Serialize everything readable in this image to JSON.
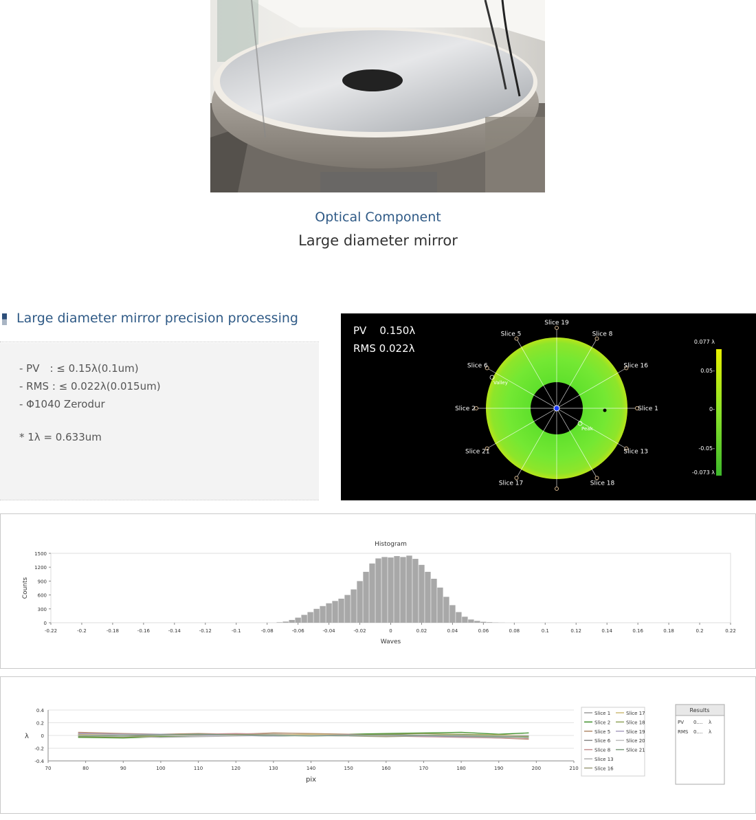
{
  "caption": {
    "category": "Optical Component",
    "title": "Large diameter mirror"
  },
  "section": {
    "title": "Large diameter mirror precision processing",
    "specs": [
      "- PV　: ≤ 0.15λ(0.1um)",
      "- RMS : ≤ 0.022λ(0.015um)",
      "- Φ1040 Zerodur"
    ],
    "note": "* 1λ = 0.633um"
  },
  "wavefront": {
    "pv_label": "PV",
    "pv_value": "0.150λ",
    "rms_label": "RMS",
    "rms_value": "0.022λ",
    "colorbar_ticks": [
      "0.077 λ",
      "0.05-",
      "0-",
      "-0.05-",
      "-0.073 λ"
    ],
    "slices": [
      {
        "label": "Slice 1",
        "angle": 0
      },
      {
        "label": "Slice 16",
        "angle": 30
      },
      {
        "label": "Slice 8",
        "angle": 60
      },
      {
        "label": "Slice 19",
        "angle": 90
      },
      {
        "label": "Slice 5",
        "angle": 120
      },
      {
        "label": "Slice 6",
        "angle": 150
      },
      {
        "label": "Slice 2",
        "angle": 180
      },
      {
        "label": "Slice 21",
        "angle": 210
      },
      {
        "label": "Slice 17",
        "angle": 240
      },
      {
        "label": "",
        "angle": 270
      },
      {
        "label": "Slice 18",
        "angle": 300
      },
      {
        "label": "Slice 13",
        "angle": 330
      }
    ],
    "valley_label": "Valley",
    "peak_label": "Peak",
    "colors": {
      "ring": "#6be82a",
      "ring_edge": "#9ee000",
      "background": "#000000"
    }
  },
  "chart_data": [
    {
      "type": "bar",
      "title": "Histogram",
      "xlabel": "Waves",
      "ylabel": "Counts",
      "xlim": [
        -0.22,
        0.22
      ],
      "ylim": [
        0,
        1500
      ],
      "x_ticks": [
        -0.22,
        -0.2,
        -0.18,
        -0.16,
        -0.14,
        -0.12,
        -0.1,
        -0.08,
        -0.06,
        -0.04,
        -0.02,
        0,
        0.02,
        0.04,
        0.06,
        0.08,
        0.1,
        0.12,
        0.14,
        0.16,
        0.18,
        0.2,
        0.22
      ],
      "y_ticks": [
        0,
        300,
        600,
        900,
        1200,
        1500
      ],
      "x": [
        -0.072,
        -0.068,
        -0.064,
        -0.06,
        -0.056,
        -0.052,
        -0.048,
        -0.044,
        -0.04,
        -0.036,
        -0.032,
        -0.028,
        -0.024,
        -0.02,
        -0.016,
        -0.012,
        -0.008,
        -0.004,
        0,
        0.004,
        0.008,
        0.012,
        0.016,
        0.02,
        0.024,
        0.028,
        0.032,
        0.036,
        0.04,
        0.044,
        0.048,
        0.052,
        0.056,
        0.06,
        0.064,
        0.068,
        0.072
      ],
      "values": [
        10,
        25,
        60,
        110,
        170,
        230,
        300,
        360,
        420,
        470,
        520,
        600,
        720,
        900,
        1100,
        1280,
        1390,
        1420,
        1410,
        1440,
        1420,
        1450,
        1380,
        1250,
        1100,
        950,
        760,
        560,
        380,
        230,
        130,
        70,
        40,
        20,
        12,
        6,
        3
      ],
      "grid": false,
      "bar_color": "#a8a8a8"
    },
    {
      "type": "line",
      "xlabel": "pix",
      "ylabel": "λ",
      "xlim": [
        70,
        210
      ],
      "ylim": [
        -0.4,
        0.4
      ],
      "x_ticks": [
        70,
        80,
        90,
        100,
        110,
        120,
        130,
        140,
        150,
        160,
        170,
        180,
        190,
        200,
        210
      ],
      "y_ticks": [
        -0.4,
        -0.2,
        0,
        0.2,
        0.4
      ],
      "grid": true,
      "legend": "right",
      "x": [
        78,
        90,
        100,
        110,
        120,
        130,
        140,
        150,
        160,
        170,
        180,
        190,
        198
      ],
      "series": [
        {
          "name": "Slice 1",
          "color": "#9a9a9a",
          "values": [
            0.02,
            0.01,
            0.0,
            0.01,
            0.02,
            0.01,
            0.0,
            0.01,
            0.02,
            0.0,
            -0.01,
            -0.02,
            -0.01
          ]
        },
        {
          "name": "Slice 2",
          "color": "#3e8f2a",
          "values": [
            -0.03,
            -0.04,
            -0.02,
            -0.01,
            0.0,
            -0.01,
            0.0,
            0.02,
            0.03,
            0.04,
            0.05,
            0.02,
            0.04
          ]
        },
        {
          "name": "Slice 5",
          "color": "#b08a6a",
          "values": [
            0.05,
            0.03,
            0.02,
            0.03,
            0.02,
            0.04,
            0.03,
            0.02,
            0.01,
            0.0,
            -0.02,
            -0.04,
            -0.06
          ]
        },
        {
          "name": "Slice 6",
          "color": "#8a8a8a",
          "values": [
            0.0,
            -0.02,
            -0.01,
            0.0,
            0.01,
            0.0,
            0.01,
            0.0,
            -0.01,
            0.0,
            0.01,
            0.0,
            0.0
          ]
        },
        {
          "name": "Slice 8",
          "color": "#c28e8e",
          "values": [
            0.04,
            0.02,
            0.01,
            0.02,
            0.03,
            0.02,
            0.01,
            0.0,
            -0.01,
            -0.02,
            -0.03,
            -0.04,
            -0.05
          ]
        },
        {
          "name": "Slice 13",
          "color": "#b0b0b0",
          "values": [
            -0.01,
            -0.02,
            -0.03,
            -0.02,
            -0.01,
            0.0,
            0.01,
            0.01,
            0.0,
            -0.01,
            -0.02,
            -0.03,
            -0.02
          ]
        },
        {
          "name": "Slice 16",
          "color": "#9c9c7a",
          "values": [
            0.02,
            0.0,
            -0.01,
            0.0,
            0.01,
            0.02,
            0.0,
            -0.01,
            -0.02,
            -0.01,
            0.0,
            0.01,
            0.0
          ]
        },
        {
          "name": "Slice 17",
          "color": "#cdbb77",
          "values": [
            0.01,
            0.02,
            0.01,
            0.0,
            0.0,
            0.01,
            0.02,
            0.01,
            0.0,
            0.01,
            0.02,
            0.01,
            0.0
          ]
        },
        {
          "name": "Slice 18",
          "color": "#8fa35a",
          "values": [
            -0.02,
            -0.03,
            -0.01,
            0.0,
            0.01,
            0.0,
            0.0,
            0.01,
            0.02,
            0.03,
            0.02,
            0.0,
            -0.02
          ]
        },
        {
          "name": "Slice 19",
          "color": "#a9a0c0",
          "values": [
            0.03,
            0.02,
            0.02,
            0.01,
            0.0,
            -0.01,
            0.0,
            0.01,
            0.0,
            -0.01,
            -0.02,
            -0.01,
            0.0
          ]
        },
        {
          "name": "Slice 20",
          "color": "#c0c0c0",
          "values": [
            0.0,
            0.01,
            0.0,
            -0.01,
            0.0,
            0.01,
            0.0,
            -0.01,
            0.0,
            0.01,
            0.0,
            -0.01,
            0.0
          ]
        },
        {
          "name": "Slice 21",
          "color": "#7a9a7a",
          "values": [
            -0.01,
            0.0,
            0.01,
            0.02,
            0.01,
            0.0,
            -0.01,
            0.0,
            0.01,
            0.0,
            -0.01,
            -0.02,
            -0.03
          ]
        }
      ]
    }
  ],
  "results": {
    "title": "Results",
    "rows": [
      {
        "name": "PV",
        "value": "0....",
        "unit": "λ"
      },
      {
        "name": "RMS",
        "value": "0....",
        "unit": "λ"
      }
    ]
  }
}
